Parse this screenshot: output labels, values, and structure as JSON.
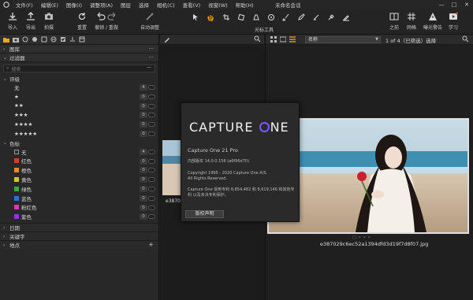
{
  "window": {
    "title": "未命名会话",
    "controls": [
      "—",
      "□",
      "✕"
    ]
  },
  "menu": [
    "文件(F)",
    "编辑(E)",
    "图像(I)",
    "调整项(A)",
    "图层",
    "选择",
    "相机(C)",
    "查看(V)",
    "视窗(W)",
    "帮助(H)"
  ],
  "toolbar": {
    "import": "导入",
    "export": "导出",
    "capture": "拍摄",
    "reset": "重置",
    "undo_redo": "撤销 / 重做",
    "auto_adjust": "自动调整",
    "cursor_tools": "光标工具",
    "before": "之前",
    "grid": "网格",
    "exposure_warning": "曝光警告",
    "learn": "学习"
  },
  "left_panel": {
    "library": "图库",
    "filters": "过滤器",
    "search_placeholder": "搜索",
    "rating_header": "评级",
    "ratings": [
      {
        "label": "无",
        "count": "4"
      },
      {
        "label": "★",
        "count": "0"
      },
      {
        "label": "★★",
        "count": "0"
      },
      {
        "label": "★★★",
        "count": "0"
      },
      {
        "label": "★★★★",
        "count": "0"
      },
      {
        "label": "★★★★★",
        "count": "0"
      }
    ],
    "color_header": "色标",
    "colors": [
      {
        "label": "无",
        "count": "4",
        "color": "#2a2a2a"
      },
      {
        "label": "红色",
        "count": "0",
        "color": "#d23a3a"
      },
      {
        "label": "橙色",
        "count": "0",
        "color": "#e08a2a"
      },
      {
        "label": "黄色",
        "count": "0",
        "color": "#d8c42a"
      },
      {
        "label": "绿色",
        "count": "0",
        "color": "#3aa84a"
      },
      {
        "label": "蓝色",
        "count": "0",
        "color": "#3a6ad8"
      },
      {
        "label": "粉红色",
        "count": "0",
        "color": "#d83ab0"
      },
      {
        "label": "紫色",
        "count": "0",
        "color": "#8a3ad8"
      }
    ],
    "date": "日期",
    "keywords": "关键字",
    "location": "地点"
  },
  "browser": {
    "sort": "名称",
    "page_count": "1 of 4（已筛选）选择",
    "main_filename": "e387029c6ec52a1394dfd3d19f7d8f07.jpg",
    "left_filename": "e3870"
  },
  "about": {
    "brand": "CAPTURE ONE",
    "version": "Capture One 21 Pro",
    "build": "内部版本 14.0.0.156 (a6f96d70)",
    "copyright_1": "Copyright 1995 - 2020 Capture One A/S.",
    "copyright_2": "All Rights Reserved.",
    "patent": "Capture One 受到专利 8,854,482 和 8,619,146 和其他专利 以及未决专利保护。",
    "license_button": "版权声明"
  },
  "colors": {
    "accent": "#f5a623",
    "brand_ring": "#7a5af8"
  }
}
